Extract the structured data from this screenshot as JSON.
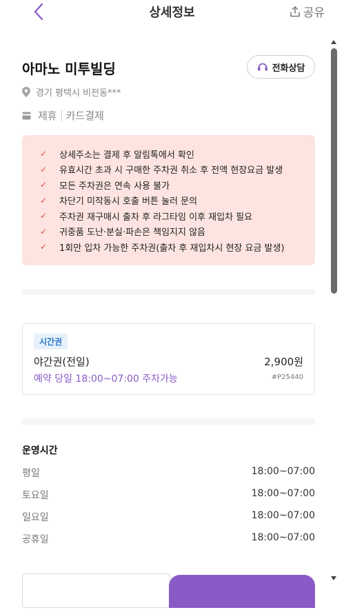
{
  "header": {
    "title": "상세정보",
    "share_label": "공유",
    "back_icon": "chevron-left-icon",
    "share_icon": "share-icon"
  },
  "place": {
    "name": "아마노 미투빌딩",
    "call_label": "전화상담",
    "address": "경기 평택시 비전동***",
    "tags": [
      "제휴",
      "카드결제"
    ]
  },
  "notices": [
    "상세주소는 결제 후 알림톡에서 확인",
    "유효시간 초과 시 구매한 주차권 취소 후 전액 현장요금 발생",
    "모든 주차권은 연속 사용 불가",
    "차단기 미작동시 호출 버튼 눌러 문의",
    "주차권 재구매시 출차 후 라그타임 이후 재입차 필요",
    "귀중품 도난·분실·파손은 책임지지 않음",
    "1회만 입차 가능한 주차권(출차 후 재입차시 현장 요금 발생)"
  ],
  "ticket": {
    "badge": "시간권",
    "name": "야간권(전일)",
    "price": "2,900원",
    "availability": "예약 당일 18:00~07:00 주차가능",
    "code": "#P25440"
  },
  "hours": {
    "title": "운영시간",
    "rows": [
      {
        "day": "평일",
        "time": "18:00~07:00"
      },
      {
        "day": "토요일",
        "time": "18:00~07:00"
      },
      {
        "day": "일요일",
        "time": "18:00~07:00"
      },
      {
        "day": "공휴일",
        "time": "18:00~07:00"
      }
    ]
  },
  "colors": {
    "accent": "#8a5bc7",
    "notice_bg": "#fde4e1",
    "check": "#e24b3a",
    "badge_bg": "#e6f1fb",
    "badge_text": "#2a73c8"
  }
}
